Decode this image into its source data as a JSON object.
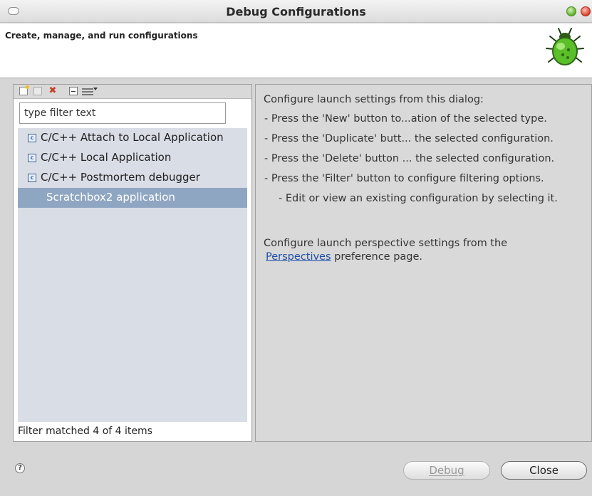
{
  "window": {
    "title": "Debug Configurations"
  },
  "banner": {
    "subtitle": "Create, manage, and run configurations"
  },
  "left_panel": {
    "toolbar_icons": [
      "new-configuration-icon",
      "duplicate-icon",
      "delete-icon",
      "collapse-all-icon",
      "filter-icon",
      "dropdown-arrow-icon"
    ],
    "filter_placeholder": "type filter text",
    "filter_value": "type filter text",
    "items": [
      {
        "label": "C/C++ Attach to Local Application",
        "icon": "c-config-icon"
      },
      {
        "label": "C/C++ Local Application",
        "icon": "c-config-icon"
      },
      {
        "label": "C/C++ Postmortem debugger",
        "icon": "c-config-icon"
      },
      {
        "label": "Scratchbox2 application",
        "selected": true
      }
    ],
    "status": "Filter matched 4 of 4 items"
  },
  "right_panel": {
    "intro": "Configure launch settings from this dialog:",
    "bullets": [
      "- Press the 'New' button to...ation of the selected type.",
      "- Press the 'Duplicate' butt... the selected configuration.",
      "- Press the 'Delete' button ... the selected configuration.",
      "- Press the 'Filter' button to configure filtering options.",
      "- Edit or view an existing configuration by selecting it."
    ],
    "perspective_text": "Configure launch perspective settings from the",
    "perspective_link": "Perspectives",
    "perspective_suffix": "preference page."
  },
  "footer": {
    "help_glyph": "?",
    "debug_label": "Debug",
    "close_label": "Close"
  },
  "colors": {
    "selection": "#8fa6c2",
    "tree_bg": "#d9dde6",
    "link": "#1f4fa8"
  }
}
